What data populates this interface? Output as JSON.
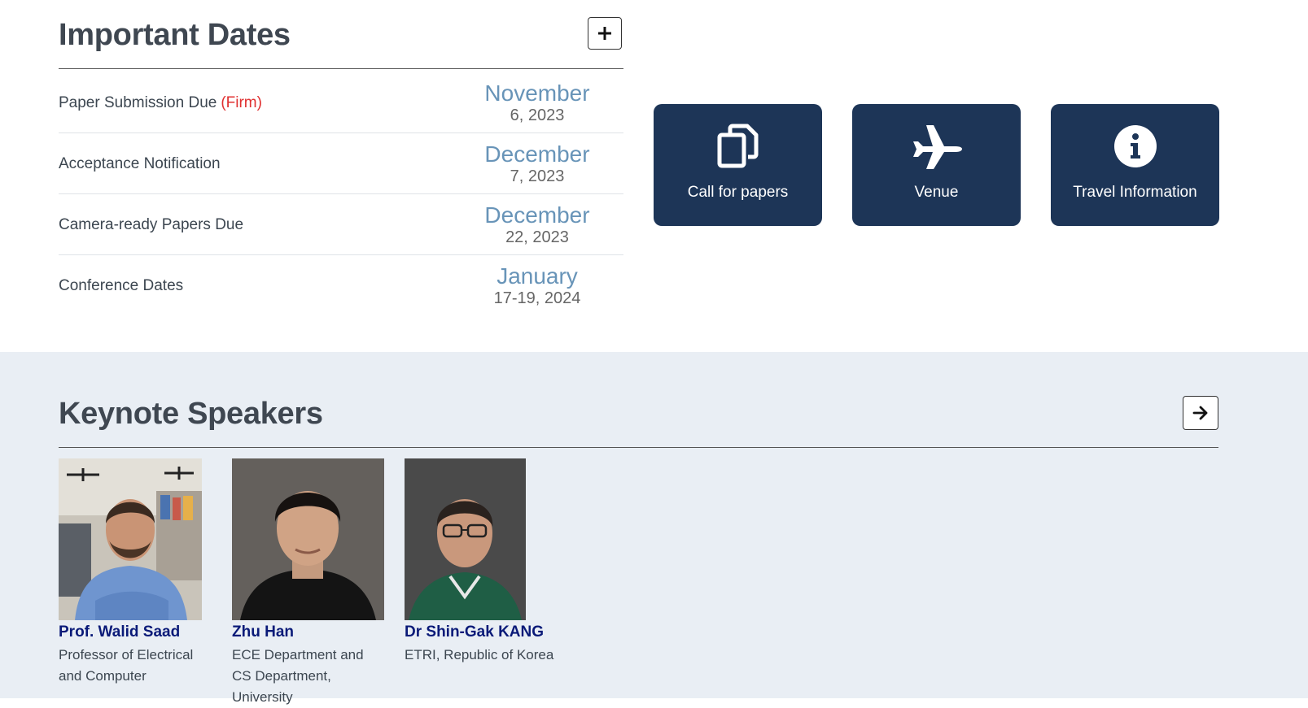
{
  "important_dates": {
    "title": "Important Dates",
    "expand_label": "+",
    "rows": [
      {
        "label": "Paper Submission Due",
        "note": "(Firm)",
        "month": "November",
        "day": "6, 2023"
      },
      {
        "label": "Acceptance Notification",
        "note": "",
        "month": "December",
        "day": "7, 2023"
      },
      {
        "label": "Camera-ready Papers Due",
        "note": "",
        "month": "December",
        "day": "22, 2023"
      },
      {
        "label": "Conference Dates",
        "note": "",
        "month": "January",
        "day": "17-19, 2024"
      }
    ]
  },
  "quick_links": [
    {
      "label": "Call for papers",
      "icon": "copy-icon"
    },
    {
      "label": "Venue",
      "icon": "airplane-icon"
    },
    {
      "label": "Travel Information",
      "icon": "info-circle-icon"
    }
  ],
  "keynote": {
    "title": "Keynote Speakers",
    "speakers": [
      {
        "name": "Prof. Walid Saad",
        "affiliation": "Professor of Electrical and Computer"
      },
      {
        "name": "Zhu Han",
        "affiliation": "ECE Department and CS Department, University"
      },
      {
        "name": "Dr Shin-Gak KANG",
        "affiliation": "ETRI, Republic of Korea"
      }
    ]
  },
  "colors": {
    "tile_bg": "#1d3557",
    "date_month": "#6894b8",
    "firm_note": "#e03030",
    "speaker_name": "#0a1a78",
    "section_bg": "#e9eef4"
  }
}
